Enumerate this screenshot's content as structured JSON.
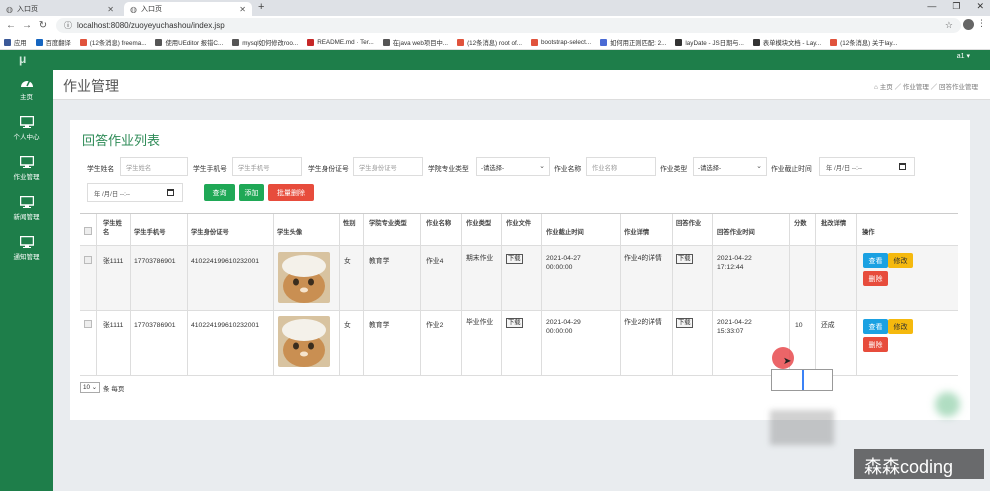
{
  "browser": {
    "tabs": [
      {
        "title": "入口页"
      },
      {
        "title": "入口页"
      }
    ],
    "url": "localhost:8080/zuoyeyuchashou/index.jsp",
    "bookmarks": [
      {
        "label": "应用",
        "color": "#3b5998"
      },
      {
        "label": "百度翻译",
        "color": "#1565c0"
      },
      {
        "label": "(12条消息) freema...",
        "color": "#e0533c"
      },
      {
        "label": "使用UEditor 报错C...",
        "color": "#555555"
      },
      {
        "label": "mysql如何修改roo...",
        "color": "#555555"
      },
      {
        "label": "README.md · Ter...",
        "color": "#c62828"
      },
      {
        "label": "在java web项目中...",
        "color": "#555555"
      },
      {
        "label": "(12条消息) root of...",
        "color": "#e0533c"
      },
      {
        "label": "bootstrap-select...",
        "color": "#e0533c"
      },
      {
        "label": "如何用正则匹配: 2...",
        "color": "#4a6ad4"
      },
      {
        "label": "layDate - JS日期与...",
        "color": "#333333"
      },
      {
        "label": "表单模块文档 - Lay...",
        "color": "#333333"
      },
      {
        "label": "(12条消息) 关于lay...",
        "color": "#e0533c"
      }
    ]
  },
  "app": {
    "logo": "μ",
    "user": "a1 ▾",
    "sidebar": [
      {
        "label": "主页",
        "icon": "dashboard-icon"
      },
      {
        "label": "个人中心",
        "icon": "monitor-icon"
      },
      {
        "label": "作业管理",
        "icon": "monitor-icon"
      },
      {
        "label": "新闻管理",
        "icon": "monitor-icon"
      },
      {
        "label": "通知管理",
        "icon": "monitor-icon"
      }
    ]
  },
  "page": {
    "title": "作业管理",
    "breadcrumb": "主页 ／ 作业管理 ／ 回答作业管理",
    "panel_title": "回答作业列表"
  },
  "filters": {
    "student_name_label": "学生姓名",
    "student_name_placeholder": "学生姓名",
    "student_phone_label": "学生手机号",
    "student_phone_placeholder": "学生手机号",
    "student_id_label": "学生身份证号",
    "student_id_placeholder": "学生身份证号",
    "major_label": "学院专业类型",
    "major_value": "-请选择-",
    "hw_name_label": "作业名称",
    "hw_name_placeholder": "作业名称",
    "hw_type_label": "作业类型",
    "hw_type_value": "-请选择-",
    "deadline_label": "作业截止时间",
    "date_placeholder": "年 /月/日 --:--",
    "date_placeholder2": "年 /月/日 --:--",
    "search_button": "查询",
    "add_button": "添加",
    "batch_delete_button": "批量删除"
  },
  "table": {
    "headers": [
      "学生姓名",
      "学生手机号",
      "学生身份证号",
      "学生头像",
      "性别",
      "学院专业类型",
      "作业名称",
      "作业类型",
      "作业文件",
      "作业截止时间",
      "作业详情",
      "回答作业",
      "回答作业时间",
      "分数",
      "批改详情",
      "操作"
    ],
    "rows": [
      {
        "name": "张1111",
        "phone": "17703786901",
        "id_no": "410224199610232001",
        "gender": "女",
        "major": "教育学",
        "hw_name": "作业4",
        "hw_type": "期末作业",
        "file": "下载",
        "deadline": "2021-04-27 00:00:00",
        "detail": "作业4的详情",
        "answer": "下载",
        "answer_time": "2021-04-22 17:12:44",
        "score": "",
        "review": "",
        "view": "查看",
        "edit": "修改",
        "delete": "删除"
      },
      {
        "name": "张1111",
        "phone": "17703786901",
        "id_no": "410224199610232001",
        "gender": "女",
        "major": "教育学",
        "hw_name": "作业2",
        "hw_type": "毕业作业",
        "file": "下载",
        "deadline": "2021-04-29 00:00:00",
        "detail": "作业2的详情",
        "answer": "下载",
        "answer_time": "2021-04-22 15:33:07",
        "score": "10",
        "review": "还成",
        "view": "查看",
        "edit": "修改",
        "delete": "删除"
      }
    ]
  },
  "pager": {
    "size": "10",
    "label": "条 每页"
  },
  "watermark": "森森coding"
}
